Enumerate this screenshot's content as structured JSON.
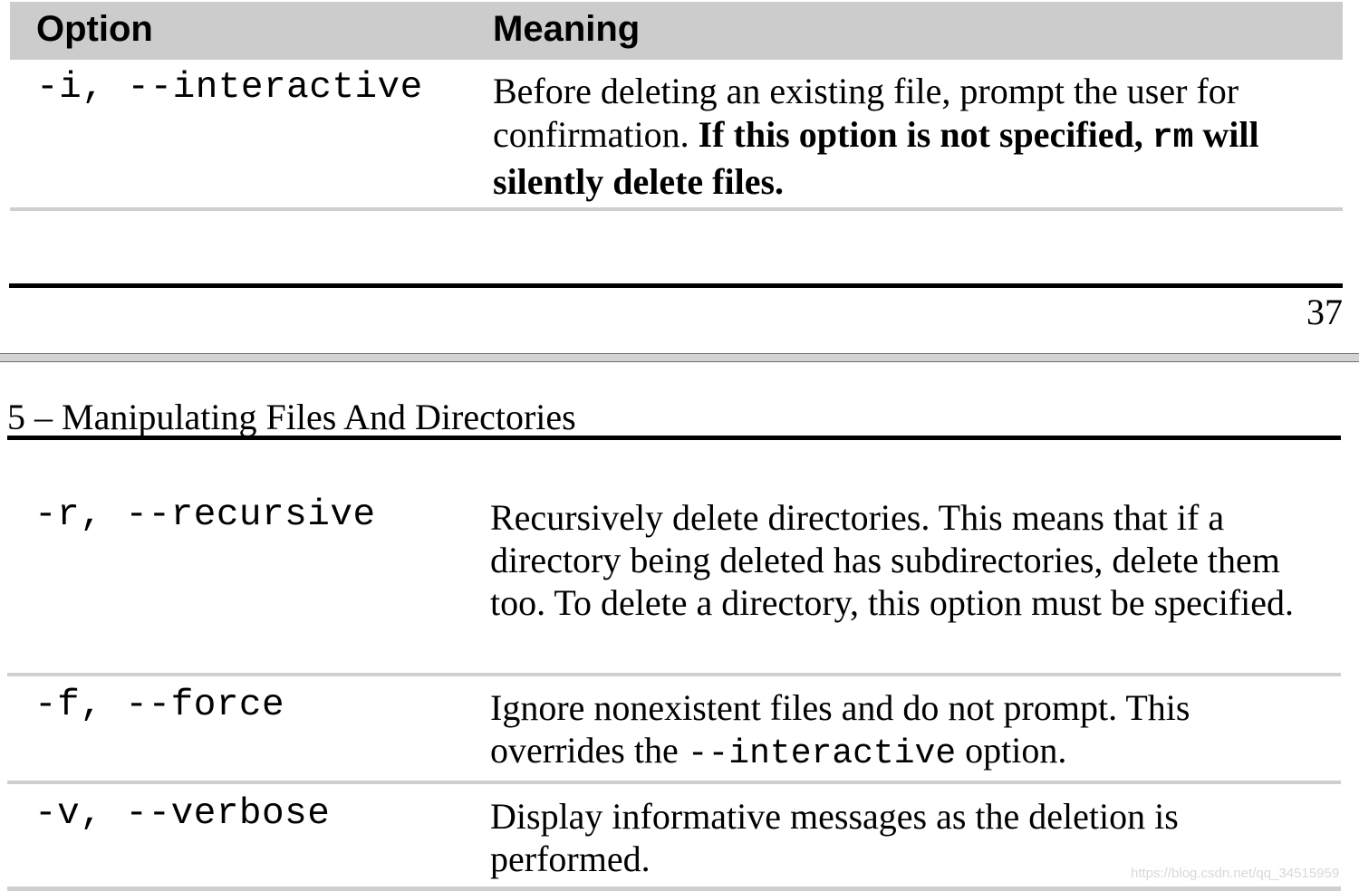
{
  "table_top": {
    "headers": {
      "option": "Option",
      "meaning": "Meaning"
    },
    "rows": [
      {
        "option": "-i, --interactive",
        "meaning_plain": "Before deleting an existing file, prompt the user for confirmation.  ",
        "meaning_bold_1": "If this option is not specified, ",
        "meaning_bold_code": "rm",
        "meaning_bold_2": " will silently delete files."
      }
    ]
  },
  "page_number": "37",
  "chapter_header": "5 – Manipulating Files And Directories",
  "table_bottom": {
    "rows": [
      {
        "option": "-r, --recursive",
        "meaning": "Recursively delete directories.  This means that if a directory being deleted has subdirectories, delete them too.  To delete a directory, this option must be specified."
      },
      {
        "option": "-f, --force",
        "meaning_pre": "Ignore nonexistent files and do not prompt.  This overrides the ",
        "meaning_code": "--interactive",
        "meaning_post": " option."
      },
      {
        "option": "-v, --verbose",
        "meaning": "Display informative messages as the deletion is performed."
      }
    ]
  },
  "watermark": "https://blog.csdn.net/qq_34515959"
}
